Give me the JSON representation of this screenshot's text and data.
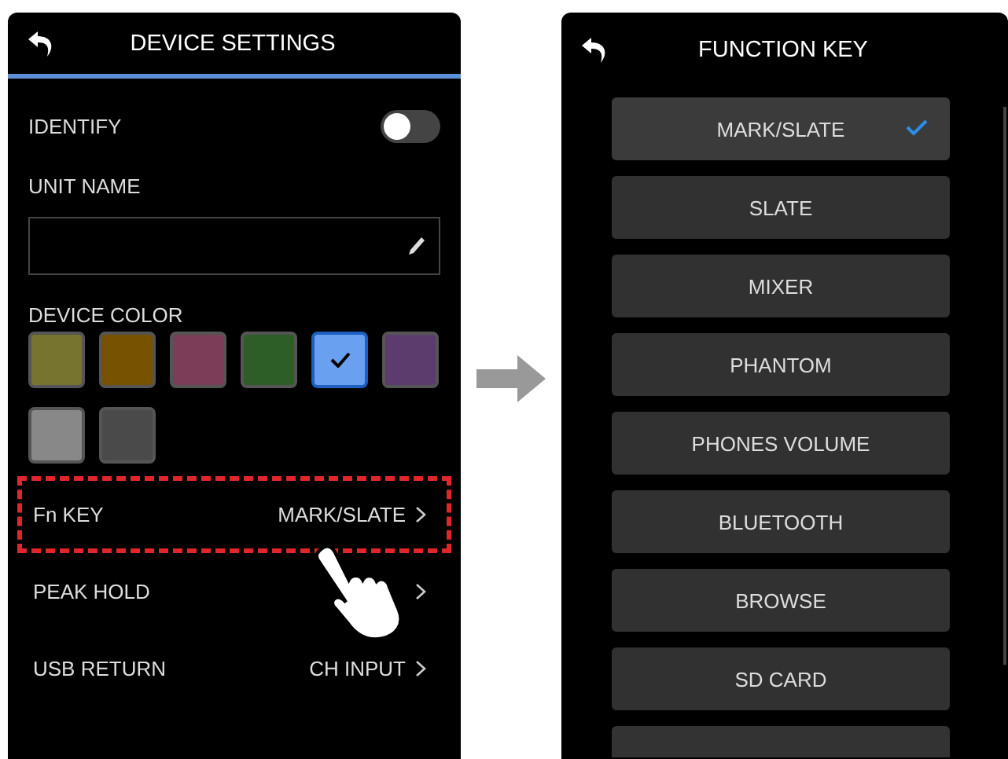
{
  "settings_screen": {
    "title": "DEVICE SETTINGS",
    "identify": {
      "label": "IDENTIFY",
      "on": false
    },
    "unit_name": {
      "label": "UNIT NAME"
    },
    "device_color": {
      "label": "DEVICE COLOR",
      "swatches": [
        {
          "color": "#76742f",
          "selected": false
        },
        {
          "color": "#775200",
          "selected": false
        },
        {
          "color": "#7b3d57",
          "selected": false
        },
        {
          "color": "#2e5e27",
          "selected": false
        },
        {
          "color": "#6aa0f0",
          "selected": true
        },
        {
          "color": "#5c3b6d",
          "selected": false
        },
        {
          "color": "#888888",
          "selected": false
        },
        {
          "color": "#4a4a4a",
          "selected": false
        }
      ]
    },
    "rows": [
      {
        "label": "Fn KEY",
        "value": "MARK/SLATE",
        "highlighted": true
      },
      {
        "label": "PEAK HOLD",
        "highlighted": false
      },
      {
        "label": "USB RETURN",
        "value": "CH INPUT",
        "highlighted": false
      }
    ]
  },
  "function_key_screen": {
    "title": "FUNCTION KEY",
    "options": [
      {
        "label": "MARK/SLATE",
        "selected": true
      },
      {
        "label": "SLATE",
        "selected": false
      },
      {
        "label": "MIXER",
        "selected": false
      },
      {
        "label": "PHANTOM",
        "selected": false
      },
      {
        "label": "PHONES VOLUME",
        "selected": false
      },
      {
        "label": "BLUETOOTH",
        "selected": false
      },
      {
        "label": "BROWSE",
        "selected": false
      },
      {
        "label": "SD CARD",
        "selected": false
      }
    ]
  }
}
